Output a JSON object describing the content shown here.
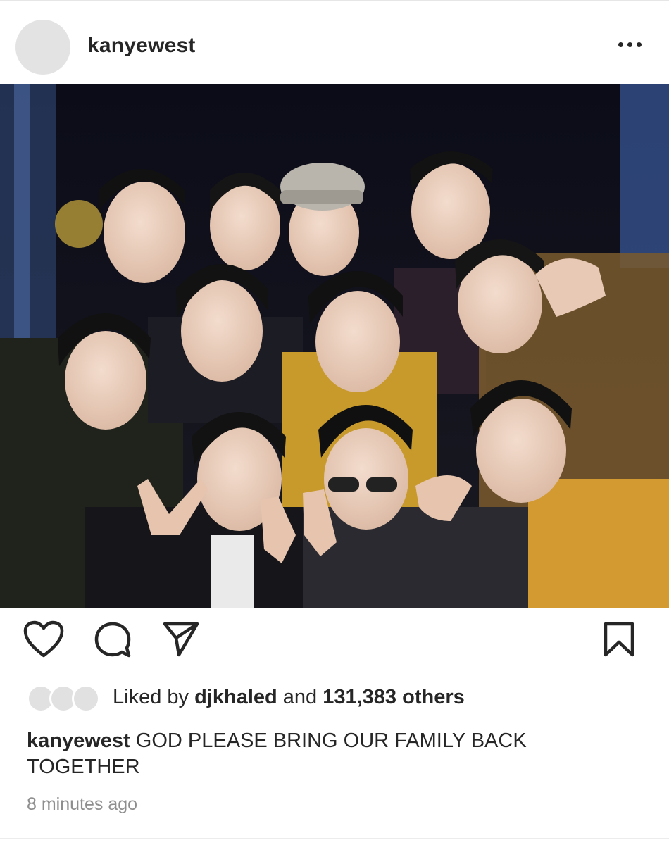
{
  "post": {
    "username": "kanyewest",
    "more_icon": "more-horizontal-icon"
  },
  "photo": {
    "description_icon": "group-photo"
  },
  "actions": {
    "like_icon": "heart-icon",
    "comment_icon": "comment-icon",
    "share_icon": "send-icon",
    "save_icon": "bookmark-icon"
  },
  "likes": {
    "prefix": "Liked by ",
    "user": "djkhaled",
    "middle": " and ",
    "count": "131,383 others"
  },
  "caption": {
    "user": "kanyewest",
    "text": " GOD PLEASE BRING OUR FAMILY BACK TOGETHER"
  },
  "timestamp": "8 minutes ago",
  "colors": {
    "text": "#262626",
    "muted": "#8e8e8e",
    "placeholder": "#e3e3e3"
  }
}
